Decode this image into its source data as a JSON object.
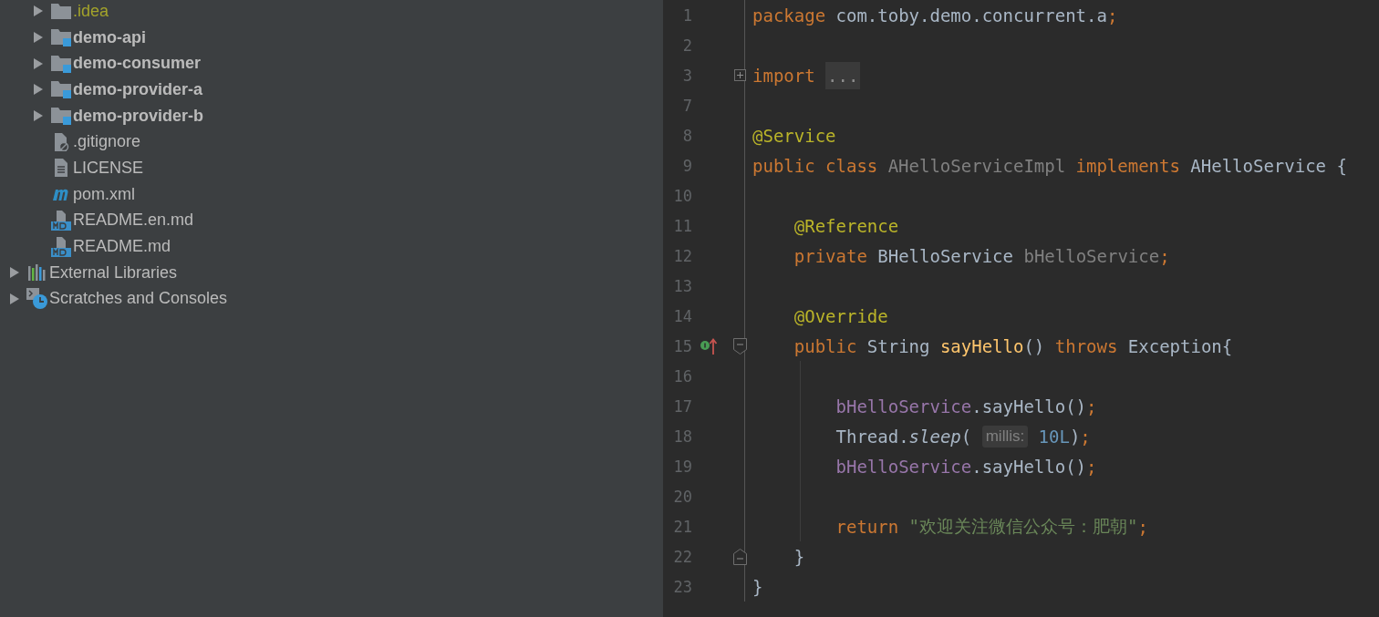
{
  "project_tree": {
    "project_items": [
      {
        "label": ".idea",
        "kind": "folder",
        "expanded": false,
        "ignored": true
      },
      {
        "label": "demo-api",
        "kind": "module",
        "expanded": false,
        "ignored": false
      },
      {
        "label": "demo-consumer",
        "kind": "module",
        "expanded": false,
        "ignored": false
      },
      {
        "label": "demo-provider-a",
        "kind": "module",
        "expanded": false,
        "ignored": false
      },
      {
        "label": "demo-provider-b",
        "kind": "module",
        "expanded": false,
        "ignored": false
      },
      {
        "label": ".gitignore",
        "kind": "gitignore",
        "ignored": false
      },
      {
        "label": "LICENSE",
        "kind": "text",
        "ignored": false
      },
      {
        "label": "pom.xml",
        "kind": "maven",
        "ignored": false
      },
      {
        "label": "README.en.md",
        "kind": "markdown",
        "ignored": false
      },
      {
        "label": "README.md",
        "kind": "markdown",
        "ignored": false
      }
    ],
    "root_items": [
      {
        "label": "External Libraries",
        "kind": "libraries",
        "expanded": false,
        "ignored": false
      },
      {
        "label": "Scratches and Consoles",
        "kind": "scratches",
        "expanded": false,
        "ignored": false
      }
    ]
  },
  "editor": {
    "lines": [
      {
        "number": "1",
        "tokens": [
          {
            "kind": "keyword",
            "text": "package"
          },
          {
            "kind": "plain",
            "text": " com.toby.demo.concurrent.a"
          },
          {
            "kind": "punct",
            "text": ";"
          }
        ]
      },
      {
        "number": "2"
      },
      {
        "number": "3",
        "folded_region": true,
        "tokens": [
          {
            "kind": "keyword",
            "text": "import"
          },
          {
            "kind": "folded",
            "text": "..."
          }
        ]
      },
      {
        "number": "7"
      },
      {
        "number": "8",
        "tokens": [
          {
            "kind": "annotation",
            "text": "@Service"
          }
        ]
      },
      {
        "number": "9",
        "tokens": [
          {
            "kind": "keyword",
            "text": "public class"
          },
          {
            "kind": "unused",
            "text": "AHelloServiceImpl"
          },
          {
            "kind": "keyword",
            "text": "implements"
          },
          {
            "kind": "plain",
            "text": "AHelloService {"
          }
        ]
      },
      {
        "number": "10"
      },
      {
        "number": "11",
        "tokens": [
          {
            "kind": "annotation",
            "text": "    @Reference"
          }
        ]
      },
      {
        "number": "12",
        "tokens": [
          {
            "kind": "keyword",
            "text": "    private"
          },
          {
            "kind": "plain",
            "text": " BHelloService "
          },
          {
            "kind": "unused",
            "text": "bHelloService"
          },
          {
            "kind": "punct",
            "text": ";"
          }
        ]
      },
      {
        "number": "13"
      },
      {
        "number": "14",
        "tokens": [
          {
            "kind": "annotation",
            "text": "    @Override"
          }
        ]
      },
      {
        "number": "15",
        "implements_marker": true,
        "fold_start": true,
        "tokens": [
          {
            "kind": "keyword",
            "text": "    public"
          },
          {
            "kind": "plain",
            "text": " String "
          },
          {
            "kind": "method",
            "text": "sayHello"
          },
          {
            "kind": "plain",
            "text": "() "
          },
          {
            "kind": "keyword",
            "text": "throws"
          },
          {
            "kind": "plain",
            "text": " Exception{"
          }
        ]
      },
      {
        "number": "16",
        "guide": true
      },
      {
        "number": "17",
        "guide": true,
        "tokens": [
          {
            "kind": "field",
            "text": "        bHelloService"
          },
          {
            "kind": "plain",
            "text": ".sayHello()"
          },
          {
            "kind": "punct",
            "text": ";"
          }
        ]
      },
      {
        "number": "18",
        "guide": true,
        "tokens": [
          {
            "kind": "plain",
            "text": "        Thread."
          },
          {
            "kind": "static",
            "text": "sleep"
          },
          {
            "kind": "plain",
            "text": "( "
          },
          {
            "kind": "hint",
            "text": "millis:"
          },
          {
            "kind": "number",
            "text": "10L"
          },
          {
            "kind": "plain",
            "text": ")"
          },
          {
            "kind": "punct",
            "text": ";"
          }
        ]
      },
      {
        "number": "19",
        "guide": true,
        "tokens": [
          {
            "kind": "field",
            "text": "        bHelloService"
          },
          {
            "kind": "plain",
            "text": ".sayHello()"
          },
          {
            "kind": "punct",
            "text": ";"
          }
        ]
      },
      {
        "number": "20",
        "guide": true
      },
      {
        "number": "21",
        "guide": true,
        "tokens": [
          {
            "kind": "keyword",
            "text": "        return"
          },
          {
            "kind": "string",
            "text": "\"欢迎关注微信公众号：肥朝\""
          },
          {
            "kind": "punct",
            "text": ";"
          }
        ]
      },
      {
        "number": "22",
        "fold_end": true,
        "tokens": [
          {
            "kind": "plain",
            "text": "    }"
          }
        ]
      },
      {
        "number": "23",
        "tokens": [
          {
            "kind": "plain",
            "text": "}"
          }
        ]
      }
    ]
  }
}
